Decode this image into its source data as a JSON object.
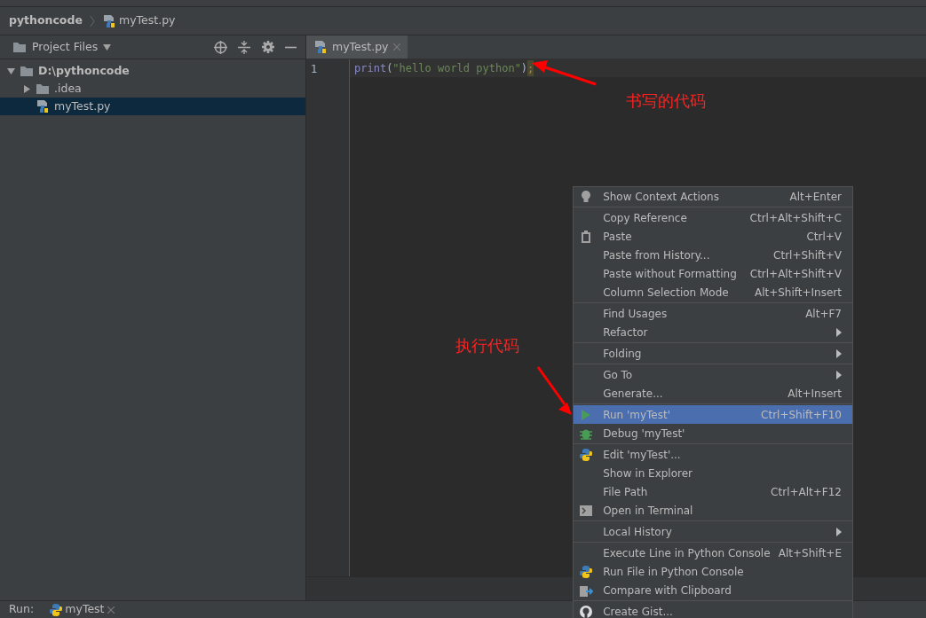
{
  "breadcrumb": [
    {
      "label": "pythoncode"
    },
    {
      "label": "myTest.py"
    }
  ],
  "project_panel": {
    "title": "Project Files",
    "tree": [
      {
        "label": "D:\\pythoncode",
        "kind": "folder",
        "expanded": true,
        "selected": false,
        "children": [
          {
            "label": ".idea",
            "kind": "folder",
            "expanded": false,
            "selected": false
          },
          {
            "label": "myTest.py",
            "kind": "file",
            "selected": true
          }
        ]
      }
    ]
  },
  "editor": {
    "tabs": [
      {
        "label": "myTest.py",
        "selected": true
      }
    ],
    "lines": [
      {
        "number": "1",
        "func": "print",
        "open": "(",
        "string": "\"hello world python\"",
        "close": ")",
        "end": ";"
      }
    ]
  },
  "annotations": [
    {
      "text": "书写的代码"
    },
    {
      "text": "执行代码"
    }
  ],
  "context_menu": [
    {
      "kind": "item",
      "label": "Show Context Actions",
      "shortcut": "Alt+Enter",
      "submenu": false,
      "selected": false
    },
    {
      "kind": "separator"
    },
    {
      "kind": "item",
      "label": "Copy Reference",
      "shortcut": "Ctrl+Alt+Shift+C",
      "submenu": false,
      "selected": false
    },
    {
      "kind": "item",
      "label": "Paste",
      "shortcut": "Ctrl+V",
      "submenu": false,
      "selected": false
    },
    {
      "kind": "item",
      "label": "Paste from History...",
      "shortcut": "Ctrl+Shift+V",
      "submenu": false,
      "selected": false
    },
    {
      "kind": "item",
      "label": "Paste without Formatting",
      "shortcut": "Ctrl+Alt+Shift+V",
      "submenu": false,
      "selected": false
    },
    {
      "kind": "item",
      "label": "Column Selection Mode",
      "shortcut": "Alt+Shift+Insert",
      "submenu": false,
      "selected": false
    },
    {
      "kind": "separator"
    },
    {
      "kind": "item",
      "label": "Find Usages",
      "shortcut": "Alt+F7",
      "submenu": false,
      "selected": false
    },
    {
      "kind": "item",
      "label": "Refactor",
      "submenu": true,
      "selected": false
    },
    {
      "kind": "separator"
    },
    {
      "kind": "item",
      "label": "Folding",
      "submenu": true,
      "selected": false
    },
    {
      "kind": "separator"
    },
    {
      "kind": "item",
      "label": "Go To",
      "submenu": true,
      "selected": false
    },
    {
      "kind": "item",
      "label": "Generate...",
      "shortcut": "Alt+Insert",
      "submenu": false,
      "selected": false
    },
    {
      "kind": "separator"
    },
    {
      "kind": "item",
      "label": "Run 'myTest'",
      "shortcut": "Ctrl+Shift+F10",
      "submenu": false,
      "selected": true
    },
    {
      "kind": "item",
      "label": "Debug 'myTest'",
      "submenu": false,
      "selected": false
    },
    {
      "kind": "separator"
    },
    {
      "kind": "item",
      "label": "Edit 'myTest'...",
      "submenu": false,
      "selected": false
    },
    {
      "kind": "item",
      "label": "Show in Explorer",
      "submenu": false,
      "selected": false
    },
    {
      "kind": "item",
      "label": "File Path",
      "shortcut": "Ctrl+Alt+F12",
      "submenu": false,
      "selected": false
    },
    {
      "kind": "item",
      "label": "Open in Terminal",
      "submenu": false,
      "selected": false
    },
    {
      "kind": "separator"
    },
    {
      "kind": "item",
      "label": "Local History",
      "submenu": true,
      "selected": false
    },
    {
      "kind": "separator"
    },
    {
      "kind": "item",
      "label": "Execute Line in Python Console",
      "shortcut": "Alt+Shift+E",
      "submenu": false,
      "selected": false
    },
    {
      "kind": "item",
      "label": "Run File in Python Console",
      "submenu": false,
      "selected": false
    },
    {
      "kind": "item",
      "label": "Compare with Clipboard",
      "submenu": false,
      "selected": false
    },
    {
      "kind": "separator"
    },
    {
      "kind": "item",
      "label": "Create Gist...",
      "submenu": false,
      "selected": false
    }
  ],
  "run_bar": {
    "label": "Run:",
    "tabs": [
      {
        "label": "myTest",
        "selected": true
      }
    ]
  }
}
